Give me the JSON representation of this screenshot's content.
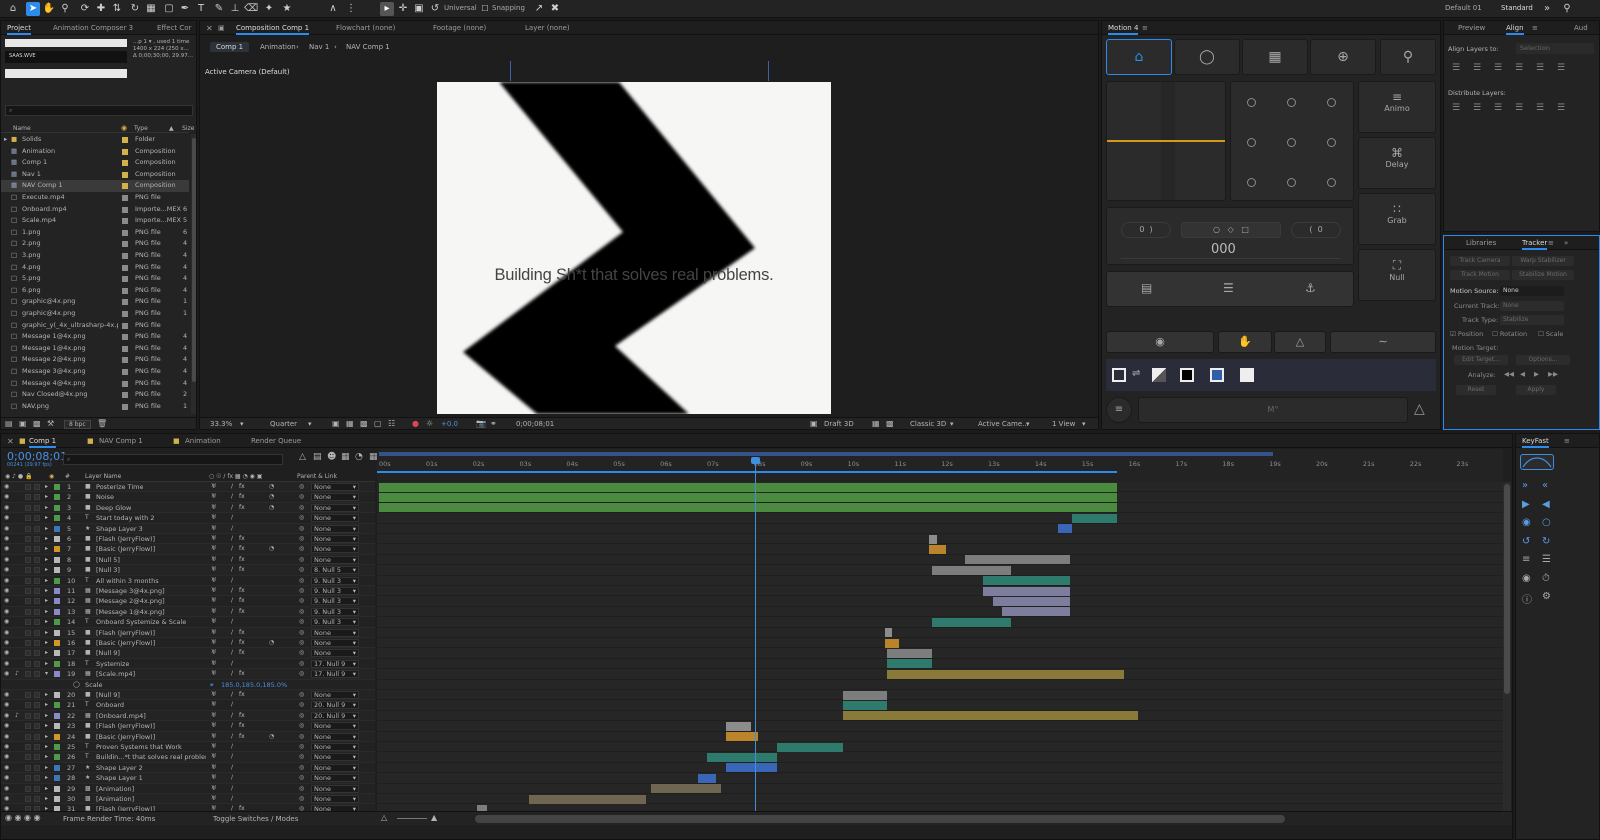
{
  "toolbar": {
    "universal_label": "Universal",
    "snapping_label": "Snapping",
    "workspace_default": "Default 01",
    "workspace_standard": "Standard",
    "icons": [
      "home-icon",
      "arrow-icon",
      "hand-icon",
      "zoom-icon",
      "camera-orbit-icon",
      "pan-behind-icon",
      "rotate-icon",
      "rectangle-icon",
      "pen-icon",
      "text-icon",
      "brush-icon",
      "stamp-icon",
      "eraser-icon",
      "roto-icon",
      "puppet-icon"
    ]
  },
  "project": {
    "tabs": [
      "Project",
      "Animation Composer 3",
      "Effect Cor"
    ],
    "preview_meta1": "...p 1 ▾ , used 1 time",
    "preview_meta2": "1400 x 224 (250 x...",
    "preview_meta3": "Δ 0;00;30;00, 29.97...",
    "preview_logo": "SAAS.WVE",
    "search_placeholder": "⌕ ",
    "columns": {
      "name": "Name",
      "type": "Type",
      "size": "Size"
    },
    "items": [
      {
        "name": "Solids",
        "type": "Folder",
        "size": "",
        "color": "#d1b24a",
        "kind": "folder"
      },
      {
        "name": "Animation",
        "type": "Composition",
        "size": "",
        "color": "#d1b24a",
        "kind": "comp"
      },
      {
        "name": "Comp 1",
        "type": "Composition",
        "size": "",
        "color": "#d1b24a",
        "kind": "comp"
      },
      {
        "name": "Nav 1",
        "type": "Composition",
        "size": "",
        "color": "#d1b24a",
        "kind": "comp"
      },
      {
        "name": "NAV Comp 1",
        "type": "Composition",
        "size": "",
        "color": "#d1b24a",
        "kind": "comp",
        "selected": true
      },
      {
        "name": "Execute.mp4",
        "type": "PNG file",
        "size": "",
        "color": "#8a8a8a",
        "kind": "file"
      },
      {
        "name": "Onboard.mp4",
        "type": "Importe...MEX",
        "size": "6",
        "color": "#8a8a8a",
        "kind": "file"
      },
      {
        "name": "Scale.mp4",
        "type": "Importe...MEX",
        "size": "5",
        "color": "#8a8a8a",
        "kind": "file"
      },
      {
        "name": "1.png",
        "type": "PNG file",
        "size": "6",
        "color": "#8a8a8a",
        "kind": "file"
      },
      {
        "name": "2.png",
        "type": "PNG file",
        "size": "4",
        "color": "#8a8a8a",
        "kind": "file"
      },
      {
        "name": "3.png",
        "type": "PNG file",
        "size": "4",
        "color": "#8a8a8a",
        "kind": "file"
      },
      {
        "name": "4.png",
        "type": "PNG file",
        "size": "4",
        "color": "#8a8a8a",
        "kind": "file"
      },
      {
        "name": "5.png",
        "type": "PNG file",
        "size": "4",
        "color": "#8a8a8a",
        "kind": "file"
      },
      {
        "name": "6.png",
        "type": "PNG file",
        "size": "4",
        "color": "#8a8a8a",
        "kind": "file"
      },
      {
        "name": "graphic@4x.png",
        "type": "PNG file",
        "size": "1",
        "color": "#8a8a8a",
        "kind": "file"
      },
      {
        "name": "graphic@4x.png",
        "type": "PNG file",
        "size": "1",
        "color": "#8a8a8a",
        "kind": "file"
      },
      {
        "name": "graphic_y(_4x_ultrasharp-4x.png",
        "type": "PNG file",
        "size": "",
        "color": "#8a8a8a",
        "kind": "file"
      },
      {
        "name": "Message 1@4x.png",
        "type": "PNG file",
        "size": "4",
        "color": "#8a8a8a",
        "kind": "file"
      },
      {
        "name": "Message 1@4x.png",
        "type": "PNG file",
        "size": "4",
        "color": "#8a8a8a",
        "kind": "file"
      },
      {
        "name": "Message 2@4x.png",
        "type": "PNG file",
        "size": "4",
        "color": "#8a8a8a",
        "kind": "file"
      },
      {
        "name": "Message 3@4x.png",
        "type": "PNG file",
        "size": "4",
        "color": "#8a8a8a",
        "kind": "file"
      },
      {
        "name": "Message 4@4x.png",
        "type": "PNG file",
        "size": "4",
        "color": "#8a8a8a",
        "kind": "file"
      },
      {
        "name": "Nav Closed@4x.png",
        "type": "PNG file",
        "size": "2",
        "color": "#8a8a8a",
        "kind": "file"
      },
      {
        "name": "NAV.png",
        "type": "PNG file",
        "size": "1",
        "color": "#8a8a8a",
        "kind": "file"
      }
    ],
    "bpc": "8 bpc"
  },
  "composition": {
    "tabs": [
      "Composition Comp 1",
      "Flowchart (none)",
      "Footage (none)",
      "Layer (none)"
    ],
    "breadcrumbs": [
      "Comp 1",
      "Animation",
      "Nav 1",
      "NAV Comp 1"
    ],
    "camera_label": "Active Camera (Default)",
    "frame_text": "Building Sh*t that solves real problems.",
    "zoom": "33.3%",
    "resolution": "Quarter",
    "exposure": "+0.0",
    "timecode": "0;00;08;01",
    "draft": "Draft 3D",
    "renderer": "Classic 3D",
    "camera_select": "Active Came...",
    "view": "1 View"
  },
  "motion": {
    "title": "Motion 4",
    "buttons": {
      "animo": "Animo",
      "delay": "Delay",
      "grab": "Grab",
      "null": "Null"
    },
    "left_value": "0",
    "right_value": "0",
    "center_value": "000",
    "bottom_label": "M°",
    "swatches": [
      "#000000",
      "#ffffff",
      "#2f5fa8",
      "#eeeeee"
    ],
    "accent": "#d19a1c"
  },
  "align": {
    "tabs": [
      "Preview",
      "Align",
      "Aud"
    ],
    "align_to_label": "Align Layers to:",
    "align_to_value": "Selection",
    "distribute_label": "Distribute Layers:"
  },
  "tracker": {
    "tabs": [
      "Libraries",
      "Tracker"
    ],
    "buttons": [
      "Track Camera",
      "Warp Stabilizer",
      "Track Motion",
      "Stabilize Motion"
    ],
    "motion_source_label": "Motion Source:",
    "motion_source_value": "None",
    "current_track_label": "Current Track:",
    "current_track_value": "None",
    "track_type_label": "Track Type:",
    "track_type_value": "Stabilize",
    "position": "Position",
    "rotation": "Rotation",
    "scale": "Scale",
    "motion_target": "Motion Target:",
    "edit_target": "Edit Target...",
    "options": "Options...",
    "analyze": "Analyze:",
    "reset": "Reset",
    "apply": "Apply"
  },
  "keyfast": {
    "title": "KeyFast"
  },
  "timeline": {
    "tabs": [
      "Comp 1",
      "NAV Comp 1",
      "Animation",
      "Render Queue"
    ],
    "timecode": "0;00;08;01",
    "fps": "00241 (29.97 fps)",
    "search_placeholder": "⌕ ",
    "col_layer_name": "Layer Name",
    "col_parent": "Parent & Link",
    "ruler": [
      "00s",
      "01s",
      "02s",
      "03s",
      "04s",
      "05s",
      "06s",
      "07s",
      "08s",
      "09s",
      "10s",
      "11s",
      "12s",
      "13s",
      "14s",
      "15s",
      "16s",
      "17s",
      "18s",
      "19s",
      "20s",
      "21s",
      "22s",
      "23s"
    ],
    "playhead_seconds": 8.03,
    "scale_value": "185.0,185.0,185.0%",
    "scale_label": "Scale",
    "footer_render": "Frame Render Time: 40ms",
    "footer_toggle": "Toggle Switches / Modes",
    "layers": [
      {
        "num": "1",
        "name": "Posterize Time",
        "color": "#4f9a4a",
        "type": "solid",
        "parent": "None",
        "start": 0,
        "end": 15.75,
        "bar": "#4a8b3f"
      },
      {
        "num": "2",
        "name": "Noise",
        "color": "#4f9a4a",
        "type": "solid",
        "parent": "None",
        "start": 0,
        "end": 15.75,
        "bar": "#4a8b3f"
      },
      {
        "num": "3",
        "name": "Deep Glow",
        "color": "#4f9a4a",
        "type": "solid",
        "parent": "None",
        "start": 0,
        "end": 15.75,
        "bar": "#4a8b3f"
      },
      {
        "num": "4",
        "name": "Start today with 2",
        "color": "#4f9a4a",
        "type": "text",
        "parent": "None",
        "start": 14.8,
        "end": 15.75,
        "bar": "#2e7a6c"
      },
      {
        "num": "5",
        "name": "Shape Layer 3",
        "color": "#3c78b8",
        "type": "shape",
        "parent": "None",
        "start": 14.5,
        "end": 14.8,
        "bar": "#3a66b8"
      },
      {
        "num": "6",
        "name": "[Flash (JerryFlow)]",
        "color": "#b8b8b8",
        "type": "solid",
        "parent": "None",
        "start": 11.75,
        "end": 11.9,
        "bar": "#8c8c8c"
      },
      {
        "num": "7",
        "name": "[Basic (JerryFlow)]",
        "color": "#d1962a",
        "type": "solid",
        "parent": "None",
        "start": 11.75,
        "end": 12.1,
        "bar": "#b9842a"
      },
      {
        "num": "8",
        "name": "[Null 5]",
        "color": "#b8b8b8",
        "type": "solid",
        "parent": "None",
        "start": 12.5,
        "end": 14.75,
        "bar": "#7d7d7d"
      },
      {
        "num": "9",
        "name": "[Null 3]",
        "color": "#b8b8b8",
        "type": "solid",
        "parent": "8. Null 5",
        "start": 11.8,
        "end": 13.5,
        "bar": "#7d7d7d"
      },
      {
        "num": "10",
        "name": "All within 3 months",
        "color": "#4f9a4a",
        "type": "text",
        "parent": "9. Null 3",
        "start": 12.9,
        "end": 14.75,
        "bar": "#2e7a6c"
      },
      {
        "num": "11",
        "name": "[Message 3@4x.png]",
        "color": "#8a8ac8",
        "type": "file",
        "parent": "9. Null 3",
        "start": 12.9,
        "end": 14.75,
        "bar": "#7d7d9e"
      },
      {
        "num": "12",
        "name": "[Message 2@4x.png]",
        "color": "#8a8ac8",
        "type": "file",
        "parent": "9. Null 3",
        "start": 13.1,
        "end": 14.75,
        "bar": "#7d7d9e"
      },
      {
        "num": "13",
        "name": "[Message 1@4x.png]",
        "color": "#8a8ac8",
        "type": "file",
        "parent": "9. Null 3",
        "start": 13.3,
        "end": 14.75,
        "bar": "#7d7d9e"
      },
      {
        "num": "14",
        "name": "Onboard Systemize & Scale",
        "color": "#4f9a4a",
        "type": "text",
        "parent": "9. Null 3",
        "start": 11.8,
        "end": 13.5,
        "bar": "#2e7a6c"
      },
      {
        "num": "15",
        "name": "[Flash (JerryFlow)]",
        "color": "#b8b8b8",
        "type": "solid",
        "parent": "None",
        "start": 10.8,
        "end": 10.95,
        "bar": "#8c8c8c"
      },
      {
        "num": "16",
        "name": "[Basic (JerryFlow)]",
        "color": "#d1962a",
        "type": "solid",
        "parent": "None",
        "start": 10.8,
        "end": 11.1,
        "bar": "#b9842a"
      },
      {
        "num": "17",
        "name": "[Null 9]",
        "color": "#b8b8b8",
        "type": "solid",
        "parent": "None",
        "start": 10.85,
        "end": 11.8,
        "bar": "#7d7d7d"
      },
      {
        "num": "18",
        "name": "Systemize",
        "color": "#4f9a4a",
        "type": "text",
        "parent": "17. Null 9",
        "start": 10.85,
        "end": 11.8,
        "bar": "#2e7a6c"
      },
      {
        "num": "19",
        "name": "[Scale.mp4]",
        "color": "#8a8ac8",
        "type": "file",
        "parent": "17. Null 9",
        "start": 10.85,
        "end": 15.9,
        "bar": "#8a7a3a",
        "expanded": true
      },
      {
        "num": "",
        "name": "",
        "color": "",
        "type": "prop",
        "parent": "",
        "start": 0,
        "end": 0,
        "bar": ""
      },
      {
        "num": "20",
        "name": "[Null 9]",
        "color": "#b8b8b8",
        "type": "solid",
        "parent": "None",
        "start": 9.9,
        "end": 10.85,
        "bar": "#7d7d7d"
      },
      {
        "num": "21",
        "name": "Onboard",
        "color": "#4f9a4a",
        "type": "text",
        "parent": "20. Null 9",
        "start": 9.9,
        "end": 10.85,
        "bar": "#2e7a6c"
      },
      {
        "num": "22",
        "name": "[Onboard.mp4]",
        "color": "#8a8ac8",
        "type": "file",
        "parent": "20. Null 9",
        "start": 9.9,
        "end": 16.2,
        "bar": "#8a7a3a"
      },
      {
        "num": "23",
        "name": "[Flash (JerryFlow)]",
        "color": "#b8b8b8",
        "type": "solid",
        "parent": "None",
        "start": 7.4,
        "end": 7.95,
        "bar": "#8c8c8c"
      },
      {
        "num": "24",
        "name": "[Basic (JerryFlow)]",
        "color": "#d1962a",
        "type": "solid",
        "parent": "None",
        "start": 7.4,
        "end": 8.1,
        "bar": "#b9842a"
      },
      {
        "num": "25",
        "name": "Proven Systems that Work",
        "color": "#4f9a4a",
        "type": "text",
        "parent": "None",
        "start": 8.5,
        "end": 9.9,
        "bar": "#2e7a6c"
      },
      {
        "num": "26",
        "name": "Buildin...*t that solves real problems.",
        "color": "#4f9a4a",
        "type": "text",
        "parent": "None",
        "start": 7.0,
        "end": 8.5,
        "bar": "#2e7a6c"
      },
      {
        "num": "27",
        "name": "Shape Layer 2",
        "color": "#3c78b8",
        "type": "shape",
        "parent": "None",
        "start": 7.4,
        "end": 8.5,
        "bar": "#3a66b8"
      },
      {
        "num": "28",
        "name": "Shape Layer 1",
        "color": "#3c78b8",
        "type": "shape",
        "parent": "None",
        "start": 6.8,
        "end": 7.2,
        "bar": "#3a66b8"
      },
      {
        "num": "29",
        "name": "[Animation]",
        "color": "#b8b8b8",
        "type": "comp",
        "parent": "None",
        "start": 5.8,
        "end": 7.3,
        "bar": "#6e6650"
      },
      {
        "num": "30",
        "name": "[Animation]",
        "color": "#b8b8b8",
        "type": "comp",
        "parent": "None",
        "start": 3.2,
        "end": 5.7,
        "bar": "#6e6650"
      },
      {
        "num": "31",
        "name": "[Flash (JerryFlow)]",
        "color": "#b8b8b8",
        "type": "solid",
        "parent": "None",
        "start": 2.1,
        "end": 2.3,
        "bar": "#7d7d7d"
      }
    ]
  }
}
